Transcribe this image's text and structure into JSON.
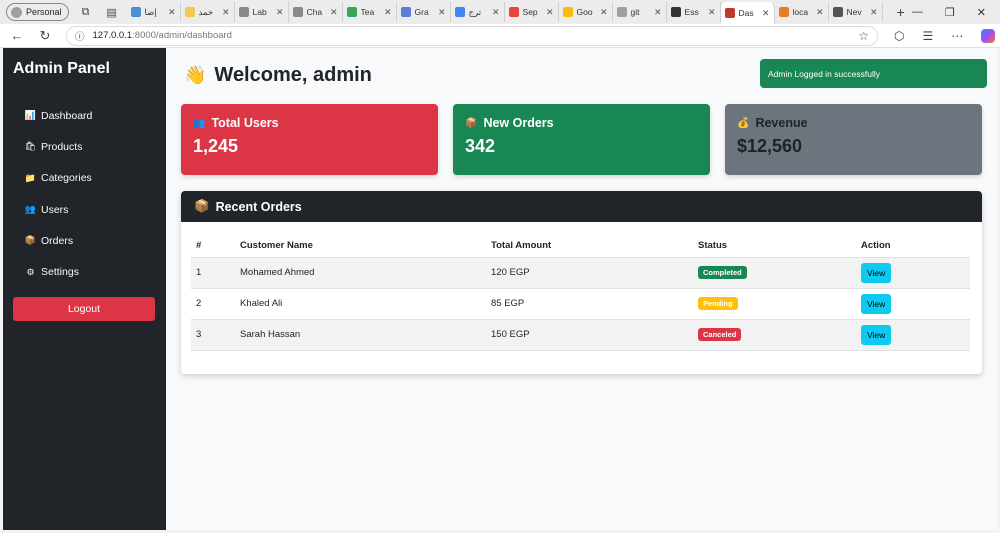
{
  "browser": {
    "profile_label": "Personal",
    "tabs": [
      {
        "title": "إضا",
        "color": "#4a90d9"
      },
      {
        "title": "خمد",
        "color": "#f2c94c"
      },
      {
        "title": "Lab",
        "color": "#8a8a8a"
      },
      {
        "title": "Cha",
        "color": "#8a8a8a"
      },
      {
        "title": "Tea",
        "color": "#34a853"
      },
      {
        "title": "Gra",
        "color": "#5b7fd6"
      },
      {
        "title": "ترج",
        "color": "#4285f4"
      },
      {
        "title": "Sep",
        "color": "#e8453c"
      },
      {
        "title": "Goo",
        "color": "#fbbc05"
      },
      {
        "title": "git",
        "color": "#9aa0a6"
      },
      {
        "title": "Ess",
        "color": "#333333"
      },
      {
        "title": "Das",
        "color": "#c0392b",
        "active": true
      },
      {
        "title": "loca",
        "color": "#e67e22"
      },
      {
        "title": "Nev",
        "color": "#555555"
      }
    ],
    "url_host": "127.0.0.1",
    "url_path": ":8000/admin/dashboard"
  },
  "sidebar": {
    "brand": "Admin Panel",
    "items": [
      {
        "label": "Dashboard",
        "icon": "📊"
      },
      {
        "label": "Products",
        "icon": "🛍"
      },
      {
        "label": "Categories",
        "icon": "📁"
      },
      {
        "label": "Users",
        "icon": "👥"
      },
      {
        "label": "Orders",
        "icon": "📦"
      },
      {
        "label": "Settings",
        "icon": "⚙"
      }
    ],
    "logout_label": "Logout"
  },
  "header": {
    "welcome_icon": "👋",
    "welcome_text": "Welcome, admin"
  },
  "toast": {
    "message": "Admin Logged in successfully"
  },
  "stats": {
    "users": {
      "icon": "👥",
      "label": "Total Users",
      "value": "1,245"
    },
    "orders": {
      "icon": "📦",
      "label": "New Orders",
      "value": "342"
    },
    "revenue": {
      "icon": "💰",
      "label": "Revenue",
      "value": "$12,560"
    }
  },
  "recent_orders": {
    "icon": "📦",
    "title": "Recent Orders",
    "columns": [
      "#",
      "Customer Name",
      "Total Amount",
      "Status",
      "Action"
    ],
    "rows": [
      {
        "id": "1",
        "customer": "Mohamed Ahmed",
        "amount": "120 EGP",
        "status": "Completed",
        "status_kind": "completed",
        "action": "View"
      },
      {
        "id": "2",
        "customer": "Khaled Ali",
        "amount": "85 EGP",
        "status": "Pending",
        "status_kind": "pending",
        "action": "View"
      },
      {
        "id": "3",
        "customer": "Sarah Hassan",
        "amount": "150 EGP",
        "status": "Canceled",
        "status_kind": "canceled",
        "action": "View"
      }
    ]
  },
  "colors": {
    "sidebar_bg": "#212529",
    "danger": "#dc3545",
    "success": "#198754",
    "secondary": "#6c757d",
    "warning": "#ffc107",
    "info": "#0dcaf0"
  }
}
